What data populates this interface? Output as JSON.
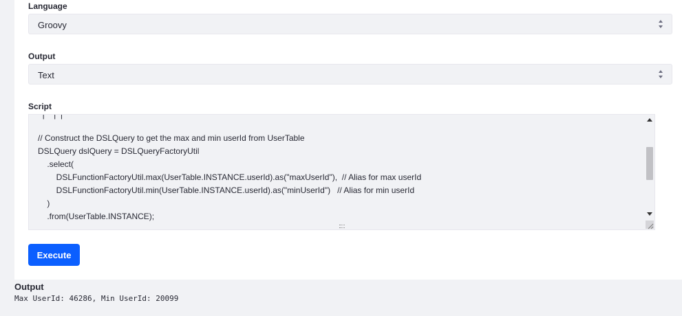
{
  "form": {
    "language": {
      "label": "Language",
      "value": "Groovy"
    },
    "output": {
      "label": "Output",
      "value": "Text"
    },
    "script": {
      "label": "Script",
      "lines": [
        "// Construct the DSLQuery to get the max and min userId from UserTable",
        "DSLQuery dslQuery = DSLQueryFactoryUtil",
        "    .select(",
        "        DSLFunctionFactoryUtil.max(UserTable.INSTANCE.userId).as(\"maxUserId\"),  // Alias for max userId",
        "        DSLFunctionFactoryUtil.min(UserTable.INSTANCE.userId).as(\"minUserId\")   // Alias for min userId",
        "    )",
        "    .from(UserTable.INSTANCE);"
      ]
    },
    "execute_label": "Execute"
  },
  "result": {
    "title": "Output",
    "text": "Max UserId: 46286, Min UserId: 20099"
  },
  "colors": {
    "accent": "#0b5fff",
    "field_bg": "#f1f2f5",
    "text": "#272833"
  }
}
